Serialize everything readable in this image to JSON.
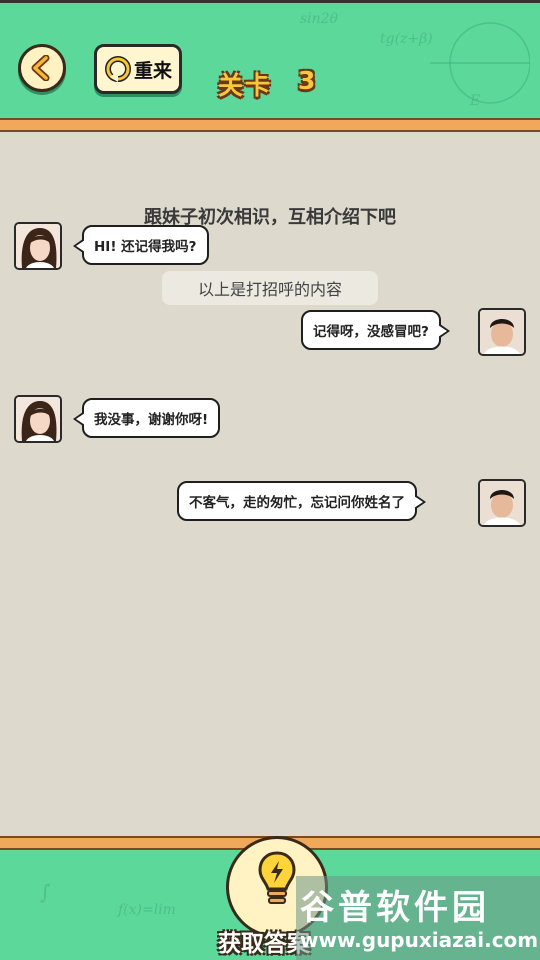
{
  "header": {
    "back_icon": "chevron-left-icon",
    "retry_icon": "refresh-icon",
    "retry_label": "重来",
    "level_label": "关卡",
    "level_number": "3",
    "bg_color": "#5cd89a",
    "band_color": "#f0a95a",
    "formulas": [
      "sin2θ",
      "tg(z+β)",
      "E",
      "f(x)=lim",
      "∫"
    ]
  },
  "task": {
    "text": "跟妹子初次相识，互相介绍下吧"
  },
  "chat": {
    "system_note": "以上是打招呼的内容",
    "messages": [
      {
        "side": "left",
        "speaker": "girl",
        "text": "HI! 还记得我吗?"
      },
      {
        "side": "right",
        "speaker": "boy",
        "text": "记得呀，没感冒吧?"
      },
      {
        "side": "left",
        "speaker": "girl",
        "text": "我没事，谢谢你呀!"
      },
      {
        "side": "right",
        "speaker": "boy",
        "text": "不客气，走的匆忙，忘记问你姓名了"
      }
    ]
  },
  "footer": {
    "hint_icon": "lightbulb-icon",
    "hint_label": "获取答案"
  },
  "watermark": {
    "title": "谷普软件园",
    "url": "www.gupuxiazai.com"
  }
}
